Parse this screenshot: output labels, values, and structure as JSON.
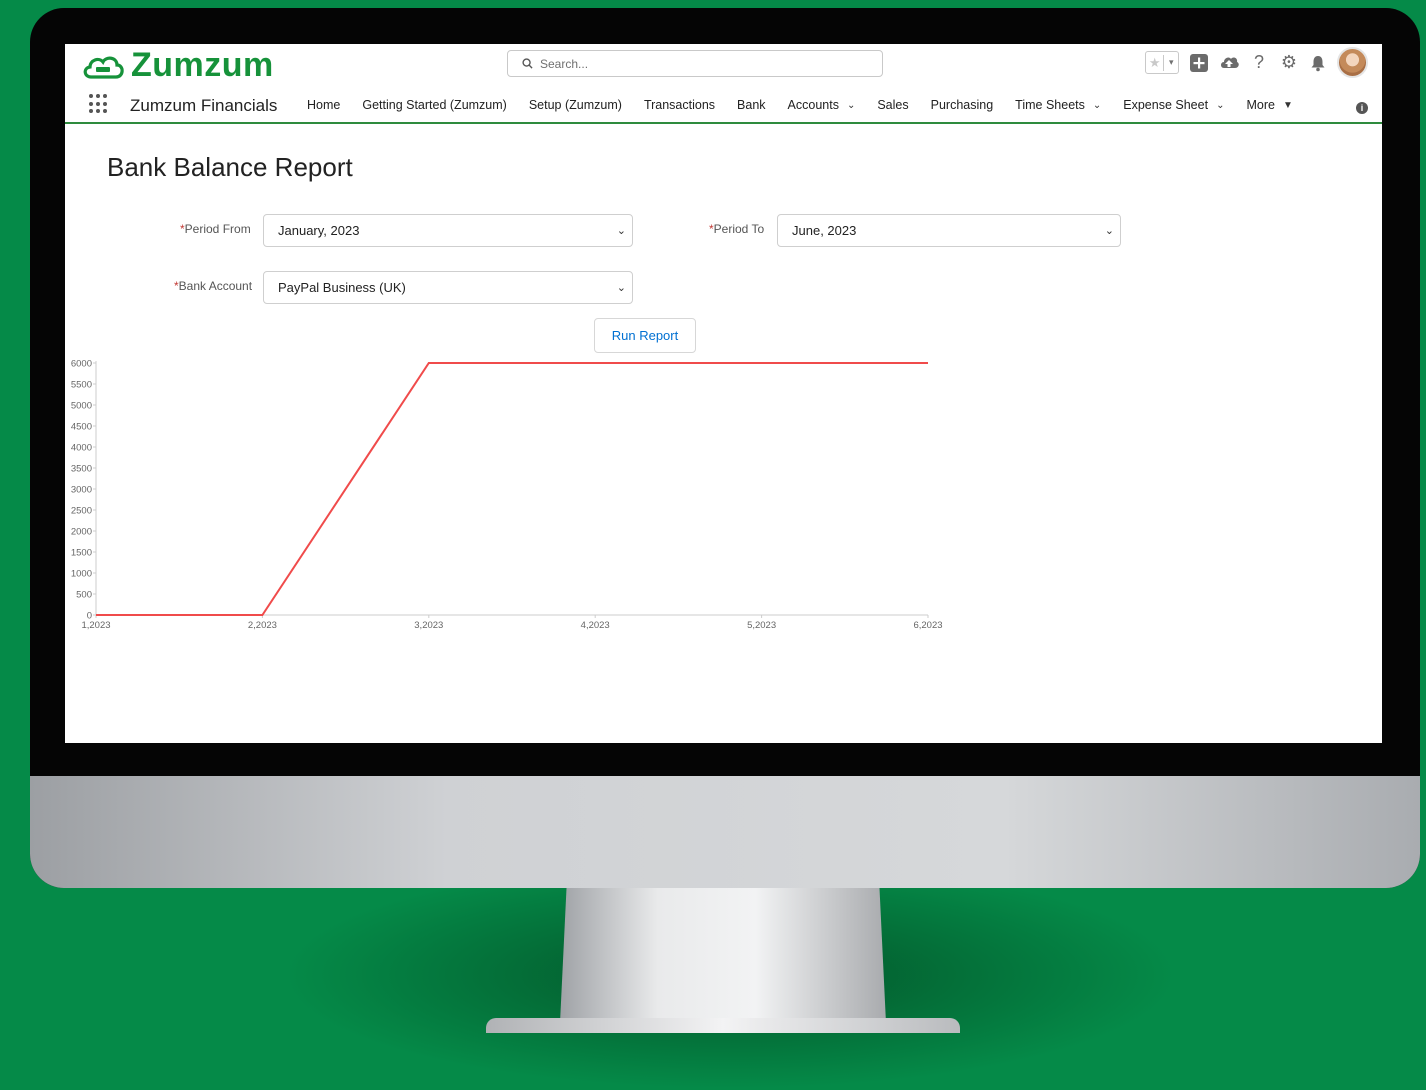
{
  "brand": {
    "logo_text": "Zumzum",
    "brand_color": "#16923a"
  },
  "search": {
    "placeholder": "Search..."
  },
  "header_icons": [
    "star-icon",
    "favorites-dropdown-icon",
    "add-icon",
    "cloud-icon",
    "help-icon",
    "settings-icon",
    "bell-icon",
    "avatar"
  ],
  "nav": {
    "app_name": "Zumzum Financials",
    "items": [
      {
        "label": "Home",
        "dropdown": false
      },
      {
        "label": "Getting Started (Zumzum)",
        "dropdown": false
      },
      {
        "label": "Setup (Zumzum)",
        "dropdown": false
      },
      {
        "label": "Transactions",
        "dropdown": false
      },
      {
        "label": "Bank",
        "dropdown": false
      },
      {
        "label": "Accounts",
        "dropdown": true
      },
      {
        "label": "Sales",
        "dropdown": false
      },
      {
        "label": "Purchasing",
        "dropdown": false
      },
      {
        "label": "Time Sheets",
        "dropdown": true
      },
      {
        "label": "Expense Sheet",
        "dropdown": true
      },
      {
        "label": "More",
        "dropdown": true
      }
    ]
  },
  "page": {
    "title": "Bank Balance Report",
    "period_from_label": "Period From",
    "period_from_value": "January, 2023",
    "period_to_label": "Period To",
    "period_to_value": "June, 2023",
    "bank_account_label": "Bank Account",
    "bank_account_value": "PayPal Business (UK)",
    "run_button": "Run Report"
  },
  "chart_data": {
    "type": "line",
    "x": [
      "1,2023",
      "2,2023",
      "3,2023",
      "4,2023",
      "5,2023",
      "6,2023"
    ],
    "series": [
      {
        "values": [
          0,
          0,
          6000,
          6000,
          6000,
          6000
        ],
        "color": "#f04b4b"
      }
    ],
    "ylim": [
      0,
      6000
    ],
    "yticks": [
      0,
      500,
      1000,
      1500,
      2000,
      2500,
      3000,
      3500,
      4000,
      4500,
      5000,
      5500,
      6000
    ],
    "grid": false,
    "title": "",
    "xlabel": "",
    "ylabel": ""
  }
}
